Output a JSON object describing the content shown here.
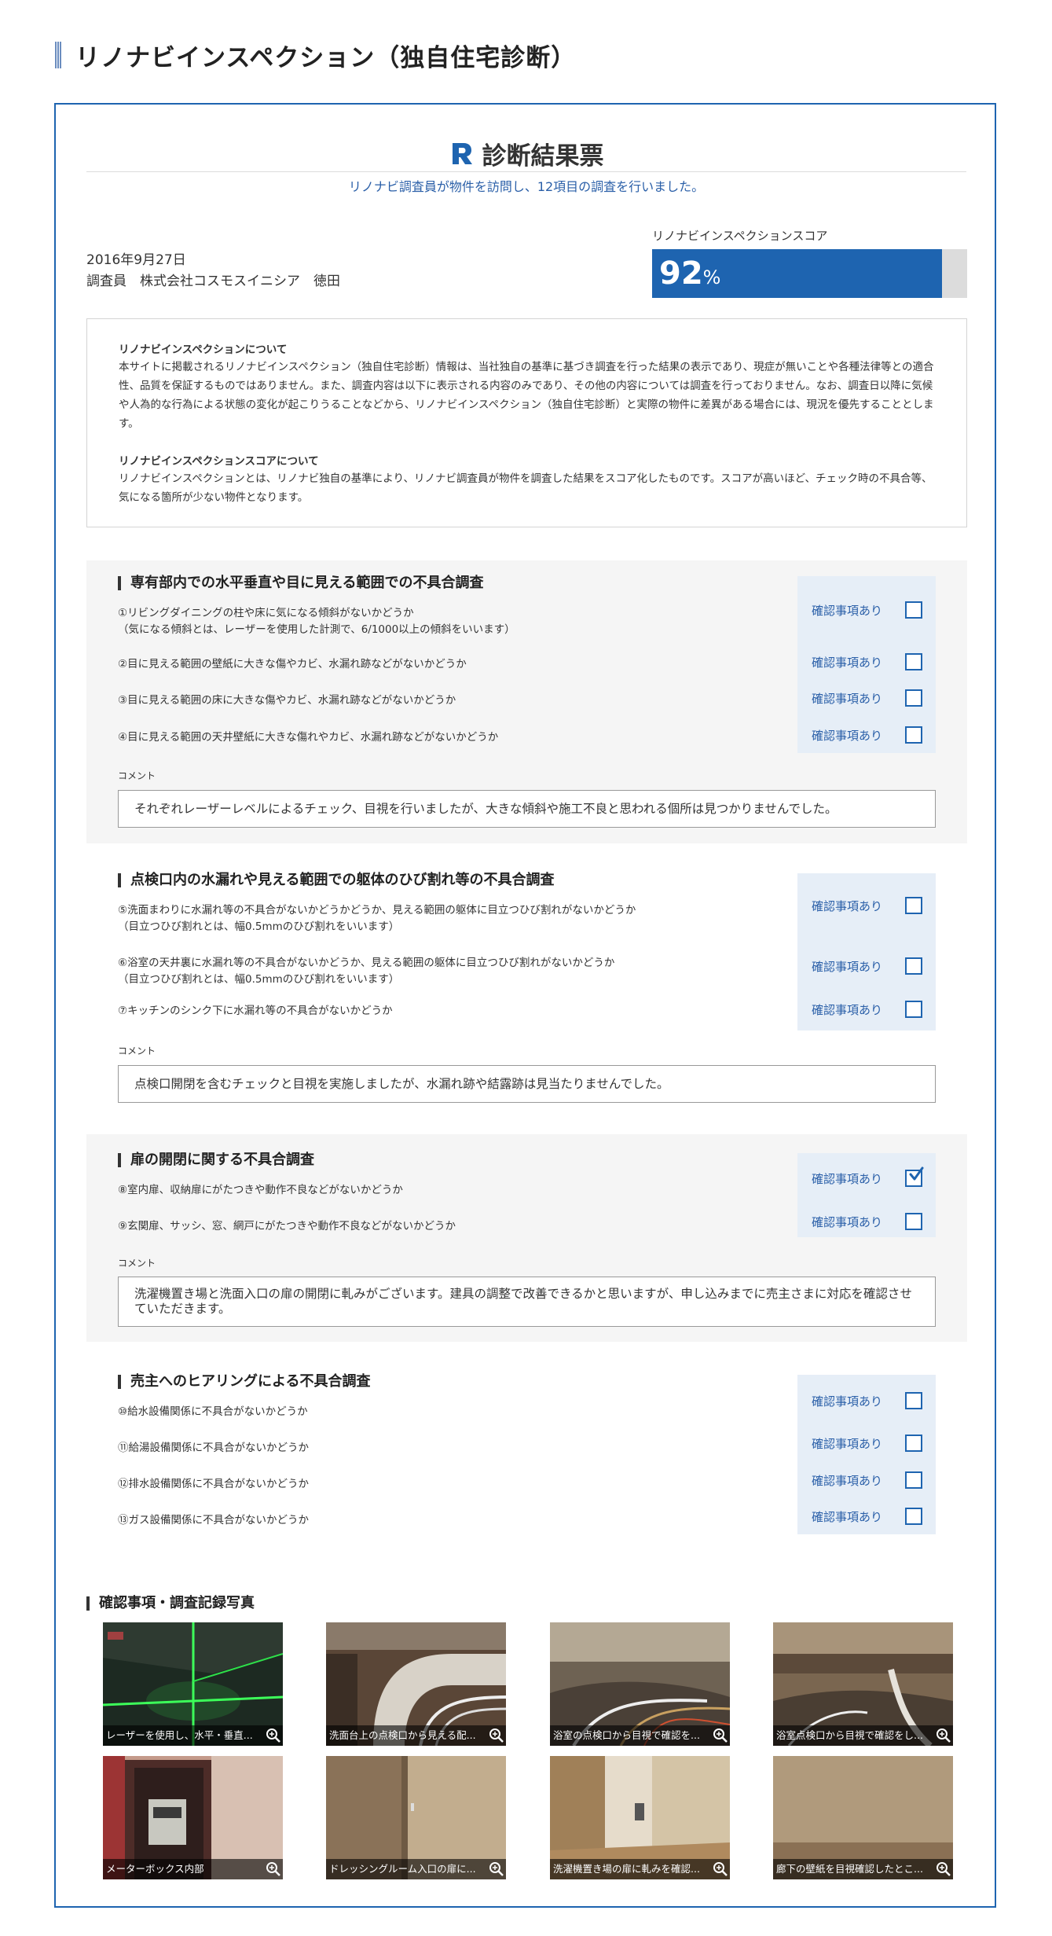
{
  "page_title": "リノナビインスペクション（独自住宅診断）",
  "result": {
    "title": "診断結果票",
    "subtitle": "リノナビ調査員が物件を訪問し、12項目の調査を行いました。",
    "date": "2016年9月27日",
    "inspector": "調査員　株式会社コスモスイニシア　徳田",
    "score_label": "リノナビインスペクションスコア",
    "score_value": "92",
    "score_unit": "%",
    "score_fraction": 0.92
  },
  "about": {
    "h1": "リノナビインスペクションについて",
    "p1": "本サイトに掲載されるリノナビインスペクション（独自住宅診断）情報は、当社独自の基準に基づき調査を行った結果の表示であり、現症が無いことや各種法律等との適合性、品質を保証するものではありません。また、調査内容は以下に表示される内容のみであり、その他の内容については調査を行っておりません。なお、調査日以降に気候や人為的な行為による状態の変化が起こりうることなどから、リノナビインスペクション（独自住宅診断）と実際の物件に差異がある場合には、現況を優先することとします。",
    "h2": "リノナビインスペクションスコアについて",
    "p2": "リノナビインスペクションとは、リノナビ独自の基準により、リノナビ調査員が物件を調査した結果をスコア化したものです。スコアが高いほど、チェック時の不具合等、気になる箇所が少ない物件となります。"
  },
  "confirm_label": "確認事項あり",
  "comment_label": "コメント",
  "sections": [
    {
      "title": "専有部内での水平垂直や目に見える範囲での不具合調査",
      "items": [
        {
          "text": "①リビングダイニングの柱や床に気になる傾斜がないかどうか",
          "note": "（気になる傾斜とは、レーザーを使用した計測で、6/1000以上の傾斜をいいます）",
          "checked": false
        },
        {
          "text": "②目に見える範囲の壁紙に大きな傷やカビ、水漏れ跡などがないかどうか",
          "note": "",
          "checked": false
        },
        {
          "text": "③目に見える範囲の床に大きな傷やカビ、水漏れ跡などがないかどうか",
          "note": "",
          "checked": false
        },
        {
          "text": "④目に見える範囲の天井壁紙に大きな傷れやカビ、水漏れ跡などがないかどうか",
          "note": "",
          "checked": false
        }
      ],
      "comment": "それぞれレーザーレベルによるチェック、目視を行いましたが、大きな傾斜や施工不良と思われる個所は見つかりませんでした。"
    },
    {
      "title": "点検口内の水漏れや見える範囲での躯体のひび割れ等の不具合調査",
      "items": [
        {
          "text": "⑤洗面まわりに水漏れ等の不具合がないかどうかどうか、見える範囲の躯体に目立つひび割れがないかどうか",
          "note": "（目立つひび割れとは、幅0.5mmのひび割れをいいます）",
          "checked": false
        },
        {
          "text": "⑥浴室の天井裏に水漏れ等の不具合がないかどうか、見える範囲の躯体に目立つひび割れがないかどうか",
          "note": "（目立つひび割れとは、幅0.5mmのひび割れをいいます）",
          "checked": false
        },
        {
          "text": "⑦キッチンのシンク下に水漏れ等の不具合がないかどうか",
          "note": "",
          "checked": false
        }
      ],
      "comment": "点検口開閉を含むチェックと目視を実施しましたが、水漏れ跡や結露跡は見当たりませんでした。"
    },
    {
      "title": "扉の開閉に関する不具合調査",
      "items": [
        {
          "text": "⑧室内扉、収納扉にがたつきや動作不良などがないかどうか",
          "note": "",
          "checked": true
        },
        {
          "text": "⑨玄関扉、サッシ、窓、網戸にがたつきや動作不良などがないかどうか",
          "note": "",
          "checked": false
        }
      ],
      "comment": "洗濯機置き場と洗面入口の扉の開閉に軋みがございます。建具の調整で改善できるかと思いますが、申し込みまでに売主さまに対応を確認させていただきます。"
    },
    {
      "title": "売主へのヒアリングによる不具合調査",
      "items": [
        {
          "text": "⑩給水設備関係に不具合がないかどうか",
          "note": "",
          "checked": false
        },
        {
          "text": "⑪給湯設備関係に不具合がないかどうか",
          "note": "",
          "checked": false
        },
        {
          "text": "⑫排水設備関係に不具合がないかどうか",
          "note": "",
          "checked": false
        },
        {
          "text": "⑬ガス設備関係に不具合がないかどうか",
          "note": "",
          "checked": false
        }
      ]
    }
  ],
  "photos_title": "確認事項・調査記録写真",
  "photos": [
    {
      "caption": "レーザーを使用し、水平・垂直..."
    },
    {
      "caption": "洗面台上の点検口から見える配..."
    },
    {
      "caption": "浴室の点検口から目視で確認を..."
    },
    {
      "caption": "浴室点検口から目視で確認をし..."
    },
    {
      "caption": "メーターボックス内部"
    },
    {
      "caption": "ドレッシングルーム入口の扉に..."
    },
    {
      "caption": "洗濯機置き場の扉に軋みを確認..."
    },
    {
      "caption": "廊下の壁紙を目視確認したとこ..."
    }
  ],
  "colors": {
    "accent": "#1e64b0",
    "label_blue": "#2a5fa8",
    "confirm_bg": "#e6eef7",
    "section_bg": "#f5f5f5"
  }
}
